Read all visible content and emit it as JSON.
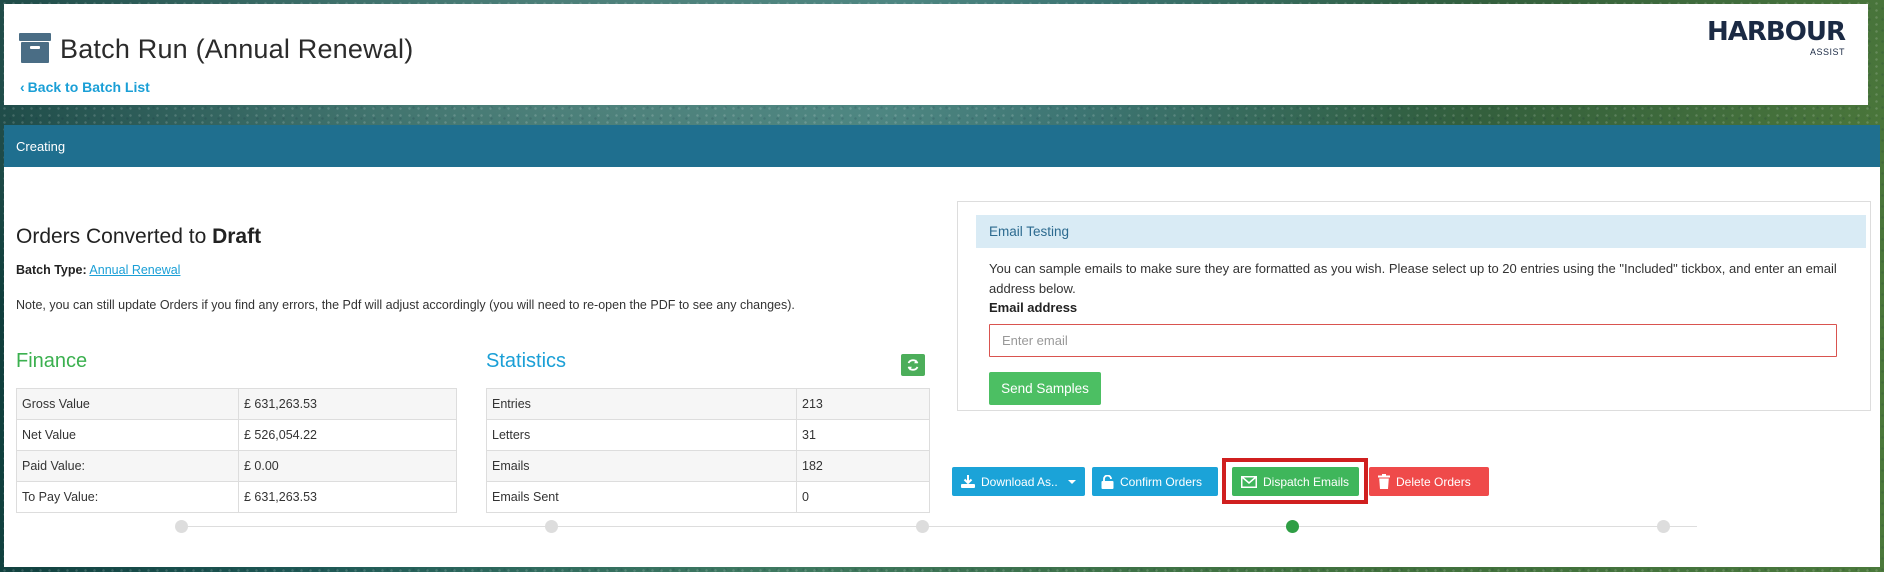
{
  "header": {
    "title": "Batch Run (Annual Renewal)",
    "back_link": "Back to Batch List",
    "logo_main": "HARBOUR",
    "logo_sub": "ASSIST"
  },
  "status": "Creating",
  "orders": {
    "heading_prefix": "Orders Converted to ",
    "heading_bold": "Draft",
    "batch_type_label": "Batch Type:",
    "batch_type_value": "Annual Renewal",
    "note": "Note, you can still update Orders if you find any errors, the Pdf will adjust accordingly (you will need to re-open the PDF to see any changes)."
  },
  "finance": {
    "title": "Finance",
    "rows": [
      {
        "label": "Gross Value",
        "value": "£ 631,263.53"
      },
      {
        "label": "Net Value",
        "value": "£ 526,054.22"
      },
      {
        "label": "Paid Value:",
        "value": "£ 0.00"
      },
      {
        "label": "To Pay Value:",
        "value": "£ 631,263.53"
      }
    ]
  },
  "statistics": {
    "title": "Statistics",
    "rows": [
      {
        "label": "Entries",
        "value": "213"
      },
      {
        "label": "Letters",
        "value": "31"
      },
      {
        "label": "Emails",
        "value": "182"
      },
      {
        "label": "Emails Sent",
        "value": "0"
      }
    ]
  },
  "email_testing": {
    "title": "Email Testing",
    "help": "You can sample emails to make sure they are formatted as you wish. Please select up to 20 entries using the \"Included\" tickbox, and enter an email address below.",
    "label": "Email address",
    "placeholder": "Enter email",
    "value": "",
    "send_label": "Send Samples"
  },
  "actions": {
    "download": "Download As..",
    "confirm": "Confirm Orders",
    "dispatch": "Dispatch Emails",
    "delete": "Delete Orders"
  },
  "stepper": {
    "steps": 5,
    "active_step": 4
  },
  "colors": {
    "status_bar": "#1f6f8f",
    "finance_title": "#3bb04f",
    "statistics_title": "#1a9fd6",
    "primary_button": "#1ba3d8",
    "success_button": "#3fb65b",
    "danger_button": "#ef4a4a",
    "highlight_border": "#d01f1f"
  },
  "icons": {
    "title": "archive-box-icon",
    "back": "chevron-left-icon",
    "refresh": "refresh-icon",
    "download": "download-icon",
    "confirm": "unlock-icon",
    "dispatch": "envelope-icon",
    "delete": "trash-icon"
  }
}
